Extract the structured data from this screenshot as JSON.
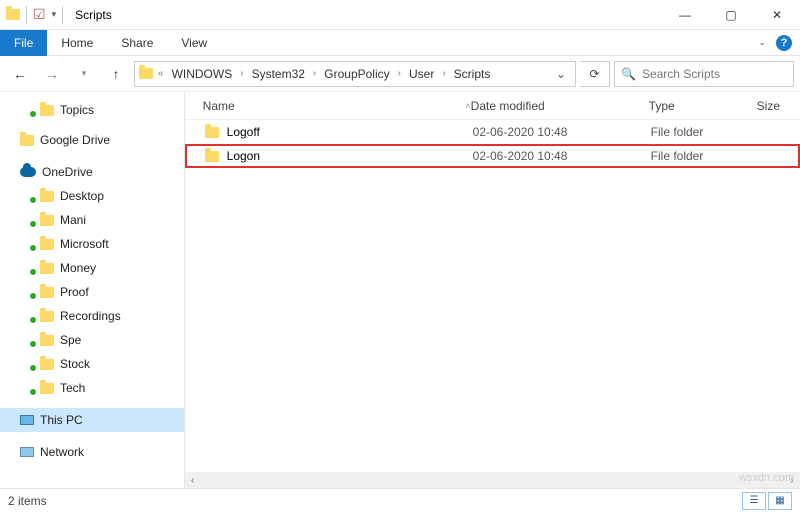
{
  "window": {
    "title": "Scripts"
  },
  "ribbon": {
    "file": "File",
    "tabs": [
      "Home",
      "Share",
      "View"
    ]
  },
  "breadcrumb": [
    "WINDOWS",
    "System32",
    "GroupPolicy",
    "User",
    "Scripts"
  ],
  "search": {
    "placeholder": "Search Scripts"
  },
  "columns": {
    "name": "Name",
    "date": "Date modified",
    "type": "Type",
    "size": "Size"
  },
  "rows": [
    {
      "name": "Logoff",
      "date": "02-06-2020 10:48",
      "type": "File folder",
      "highlight": false
    },
    {
      "name": "Logon",
      "date": "02-06-2020 10:48",
      "type": "File folder",
      "highlight": true
    }
  ],
  "sidebar": {
    "top": [
      {
        "label": "Topics",
        "icon": "folder-sync"
      },
      {
        "label": "Google Drive",
        "icon": "folder"
      }
    ],
    "onedrive": {
      "label": "OneDrive"
    },
    "onedrive_children": [
      "Desktop",
      "Mani",
      "Microsoft",
      "Money",
      "Proof",
      "Recordings",
      "Spe",
      "Stock",
      "Tech"
    ],
    "thispc": {
      "label": "This PC"
    },
    "network": {
      "label": "Network"
    }
  },
  "status": {
    "text": "2 items"
  },
  "watermark": "wsxdn.com"
}
